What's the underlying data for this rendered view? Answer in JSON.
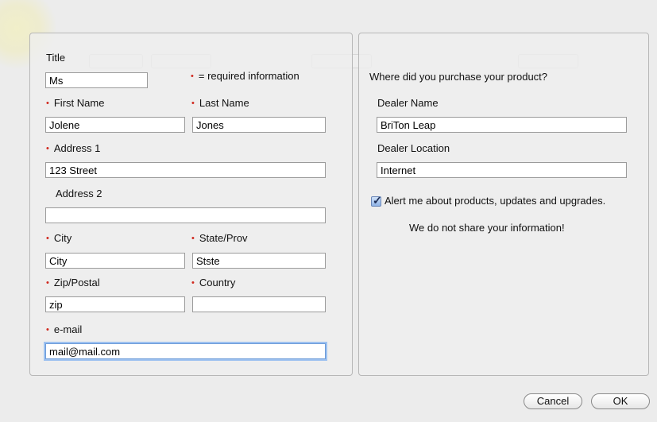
{
  "form": {
    "title_label": "Title",
    "title_value": "Ms",
    "required_note": "= required information",
    "first_name_label": "First Name",
    "first_name_value": "Jolene",
    "last_name_label": "Last Name",
    "last_name_value": "Jones",
    "address1_label": "Address 1",
    "address1_value": "123 Street",
    "address2_label": "Address 2",
    "address2_value": "",
    "city_label": "City",
    "city_value": "City",
    "state_label": "State/Prov",
    "state_value": "Stste",
    "zip_label": "Zip/Postal",
    "zip_value": "zip",
    "country_label": "Country",
    "country_value": "",
    "email_label": "e-mail",
    "email_value": "mail@mail.com",
    "required_marker": "•"
  },
  "purchase": {
    "question": "Where did you purchase your product?",
    "dealer_name_label": "Dealer Name",
    "dealer_name_value": "BriTon Leap",
    "dealer_location_label": "Dealer Location",
    "dealer_location_value": "Internet",
    "alert_label": "Alert me about products, updates and upgrades.",
    "alert_checked": true,
    "privacy_note": "We do not share your information!"
  },
  "buttons": {
    "cancel": "Cancel",
    "ok": "OK"
  },
  "colors": {
    "required": "#d0281e",
    "focus_ring": "#9ec2f0"
  }
}
